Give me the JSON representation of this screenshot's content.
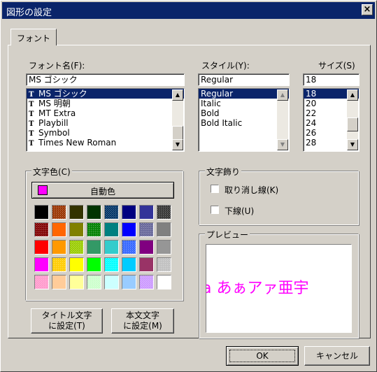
{
  "window": {
    "title": "図形の設定",
    "close_glyph": "×"
  },
  "tab": {
    "label": "フォント"
  },
  "font_name": {
    "label": "フォント名(F):",
    "value": "MS ゴシック",
    "items": [
      {
        "icon": "T",
        "label": "MS ゴシック",
        "selected": true
      },
      {
        "icon": "T",
        "label": "MS 明朝",
        "selected": false
      },
      {
        "icon": "T",
        "label": "MT Extra",
        "selected": false
      },
      {
        "icon": "T",
        "label": "Playbill",
        "selected": false
      },
      {
        "icon": "T",
        "label": "Symbol",
        "selected": false
      },
      {
        "icon": "T",
        "label": "Times New Roman",
        "selected": false
      }
    ]
  },
  "style": {
    "label": "スタイル(Y):",
    "value": "Regular",
    "items": [
      {
        "label": "Regular",
        "selected": true
      },
      {
        "label": "Italic",
        "selected": false
      },
      {
        "label": "Bold",
        "selected": false
      },
      {
        "label": "Bold Italic",
        "selected": false
      }
    ]
  },
  "size": {
    "label": "サイズ(S)",
    "value": "18",
    "items": [
      {
        "label": "18",
        "selected": true
      },
      {
        "label": "20",
        "selected": false
      },
      {
        "label": "22",
        "selected": false
      },
      {
        "label": "24",
        "selected": false
      },
      {
        "label": "26",
        "selected": false
      },
      {
        "label": "28",
        "selected": false
      }
    ]
  },
  "color": {
    "group_label": "文字色(C)",
    "auto_label": "自動色",
    "auto_swatch": "#ff00ff",
    "palette": [
      [
        "#000000",
        "#993300",
        "#333300",
        "#003300",
        "#003366",
        "#000080",
        "#333399",
        "#333333"
      ],
      [
        "#800000",
        "#ff6600",
        "#808000",
        "#008000",
        "#008080",
        "#0000ff",
        "#666699",
        "#808080"
      ],
      [
        "#ff0000",
        "#ff9900",
        "#99cc00",
        "#339966",
        "#33cccc",
        "#3366ff",
        "#800080",
        "#969696"
      ],
      [
        "#ff00ff",
        "#ffcc00",
        "#ffff00",
        "#00ff00",
        "#00ffff",
        "#00ccff",
        "#993366",
        "#c0c0c0"
      ],
      [
        "#ff99cc",
        "#ffcc99",
        "#ffff99",
        "#ccffcc",
        "#ccffff",
        "#99ccff",
        "#cc99ff",
        "#ffffff"
      ]
    ]
  },
  "decoration": {
    "group_label": "文字飾り",
    "strikethrough_label": "取り消し線(K)",
    "underline_label": "下線(U)"
  },
  "preview": {
    "group_label": "プレビュー",
    "sample": "a あぁアァ亜宇"
  },
  "buttons": {
    "title_text": [
      "タイトル文字",
      "に設定(T)"
    ],
    "body_text": [
      "本文文字",
      "に設定(M)"
    ],
    "ok": "OK",
    "cancel": "キャンセル"
  }
}
